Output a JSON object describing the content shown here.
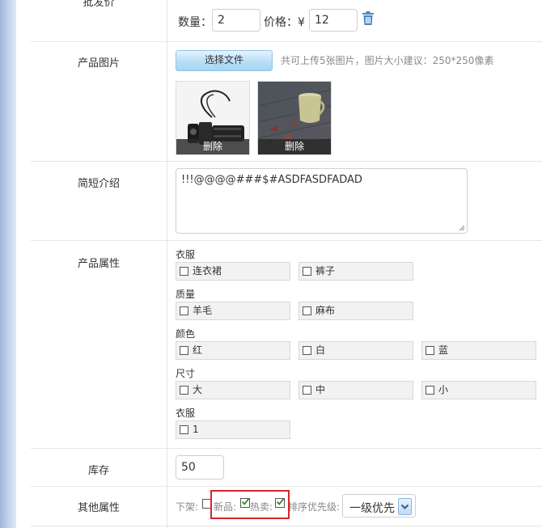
{
  "top_row": {
    "label": "批发价",
    "qty_label": "数量：",
    "qty_value": "2",
    "price_label": "价格：¥",
    "price_value": "12"
  },
  "images": {
    "label": "产品图片",
    "upload_button": "选择文件",
    "hint": "共可上传5张图片，图片大小建议：250*250像素",
    "thumbs": [
      {
        "name": "flashlight",
        "delete_label": "删除"
      },
      {
        "name": "mug",
        "delete_label": "删除"
      }
    ]
  },
  "intro": {
    "label": "简短介绍",
    "value": "!!!@@@@###$#ASDFASDFADAD"
  },
  "attributes": {
    "label": "产品属性",
    "groups": [
      {
        "title": "衣服",
        "options": [
          "连衣裙",
          "裤子"
        ]
      },
      {
        "title": "质量",
        "options": [
          "羊毛",
          "麻布"
        ]
      },
      {
        "title": "颜色",
        "options": [
          "红",
          "白",
          "蓝"
        ]
      },
      {
        "title": "尺寸",
        "options": [
          "大",
          "中",
          "小"
        ]
      },
      {
        "title": "衣服",
        "options": [
          "1"
        ]
      }
    ]
  },
  "stock": {
    "label": "库存",
    "value": "50"
  },
  "other": {
    "label": "其他属性",
    "offline_label": "下架:",
    "offline_checked": false,
    "new_label": "新品:",
    "new_checked": true,
    "hot_label": "热卖:",
    "hot_checked": true,
    "priority_label": "排序优先级:",
    "priority_value": "一级优先"
  },
  "colors": {
    "highlight": "#d9242b",
    "upload_button": "#b9def7",
    "check": "#2e8b2e"
  }
}
